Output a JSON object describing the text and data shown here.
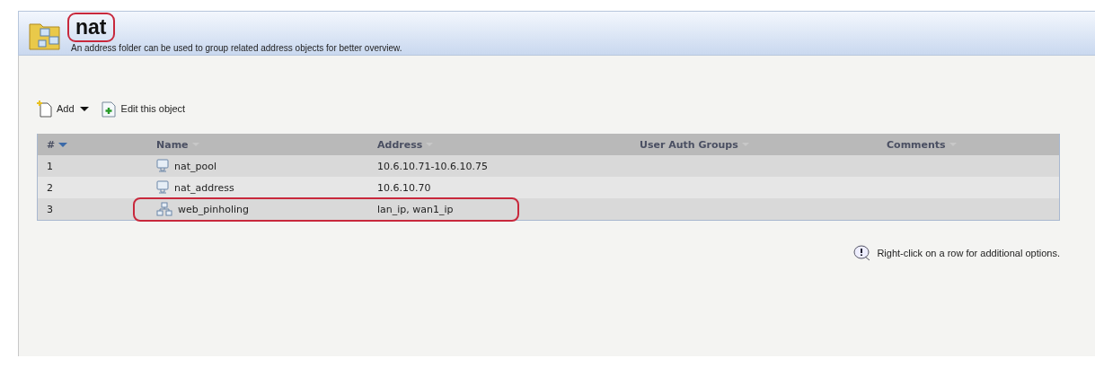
{
  "header": {
    "title": "nat",
    "title_highlighted": true,
    "description": "An address folder can be used to group related address objects for better overview."
  },
  "toolbar": [
    {
      "kind": "add",
      "label": "Add",
      "dropdown": true
    },
    {
      "kind": "edit",
      "label": "Edit this object",
      "dropdown": false
    }
  ],
  "table": {
    "columns": [
      {
        "label": "#",
        "sorted": true
      },
      {
        "label": "Name",
        "sorted": false
      },
      {
        "label": "Address",
        "sorted": false
      },
      {
        "label": "User Auth Groups",
        "sorted": false
      },
      {
        "label": "Comments",
        "sorted": false
      }
    ],
    "rows": [
      {
        "number": "1",
        "kind": "address",
        "name": "nat_pool",
        "address": "10.6.10.71-10.6.10.75",
        "highlighted": false
      },
      {
        "number": "2",
        "kind": "address",
        "name": "nat_address",
        "address": "10.6.10.70",
        "highlighted": false
      },
      {
        "number": "3",
        "kind": "group",
        "name": "web_pinholing",
        "address": "lan_ip, wan1_ip",
        "highlighted": true
      }
    ]
  },
  "hint": "Right-click on a row for additional options."
}
